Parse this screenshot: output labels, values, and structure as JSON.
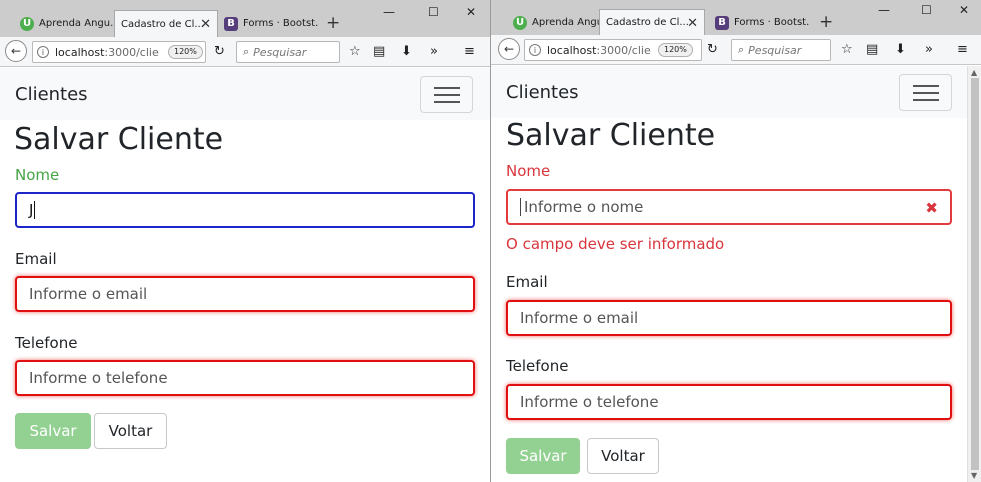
{
  "tabs": [
    {
      "label": "Aprenda Angu...",
      "favicon": "U"
    },
    {
      "label": "Cadastro de Cl...",
      "favicon": "",
      "active": true
    },
    {
      "label": "Forms · Bootst...",
      "favicon": "B"
    }
  ],
  "toolbar": {
    "url_host": "localhost",
    "url_rest": ":3000/clie",
    "zoom": "120%",
    "search_placeholder": "Pesquisar"
  },
  "app": {
    "brand": "Clientes",
    "page_title": "Salvar Cliente"
  },
  "form": {
    "name_label": "Nome",
    "name_value": "J",
    "name_placeholder": "Informe o nome",
    "name_error": "O campo deve ser informado",
    "email_label": "Email",
    "email_placeholder": "Informe o email",
    "phone_label": "Telefone",
    "phone_placeholder": "Informe o telefone",
    "save_label": "Salvar",
    "back_label": "Voltar"
  },
  "colors": {
    "valid": "#46a546",
    "invalid": "#d9353c",
    "focus_border": "#1d25c9",
    "save_button": "#93d193"
  }
}
